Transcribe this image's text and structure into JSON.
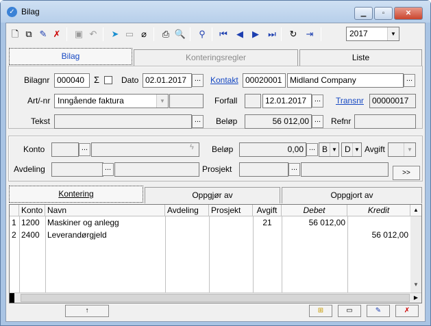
{
  "window": {
    "title": "Bilag",
    "minimize": "▁",
    "maximize": "▫",
    "close": "✕"
  },
  "toolbar": {
    "buttons": [
      "new-document",
      "copy-document",
      "edit-document",
      "delete-document",
      "save",
      "undo",
      "import",
      "open-folder",
      "attachment",
      "print",
      "print-preview",
      "search",
      "first-record",
      "previous-record",
      "next-record",
      "last-record",
      "refresh",
      "exit"
    ],
    "year": "2017"
  },
  "tabs": [
    "Bilag",
    "Konteringsregler",
    "Liste"
  ],
  "form": {
    "bilagnr_label": "Bilagnr",
    "bilagnr": "000040",
    "sigma": "Σ",
    "dato_label": "Dato",
    "dato": "02.01.2017",
    "kontakt_label": "Kontakt",
    "kontakt_id": "00020001",
    "kontakt_name": "Midland Company",
    "artnr_label": "Art/-nr",
    "artnr": "Inngående faktura",
    "forfall_label": "Forfall",
    "forfall": "12.01.2017",
    "transnr_label": "Transnr",
    "transnr": "00000017",
    "tekst_label": "Tekst",
    "tekst": "",
    "belop_label": "Beløp",
    "belop": "56 012,00",
    "refnr_label": "Refnr",
    "refnr": "",
    "dots": "..."
  },
  "posting": {
    "konto_label": "Konto",
    "belop_label": "Beløp",
    "belop": "0,00",
    "b_value": "B",
    "d_value": "D",
    "avgift_label": "Avgift",
    "avdeling_label": "Avdeling",
    "prosjekt_label": "Prosjekt",
    "more": ">>"
  },
  "subtabs": [
    "Kontering",
    "Oppgjør av",
    "Oppgjort av"
  ],
  "grid": {
    "columns": [
      "",
      "Konto",
      "Navn",
      "Avdeling",
      "Prosjekt",
      "Avgift",
      "Debet",
      "Kredit"
    ],
    "rows": [
      {
        "n": "1",
        "konto": "1200",
        "navn": "Maskiner og anlegg",
        "avdeling": "",
        "prosjekt": "",
        "avgift": "21",
        "debet": "56 012,00",
        "kredit": ""
      },
      {
        "n": "2",
        "konto": "2400",
        "navn": "Leverandørgjeld",
        "avdeling": "",
        "prosjekt": "",
        "avgift": "",
        "debet": "",
        "kredit": "56 012,00"
      }
    ]
  },
  "bottom": {
    "up": "↑"
  }
}
